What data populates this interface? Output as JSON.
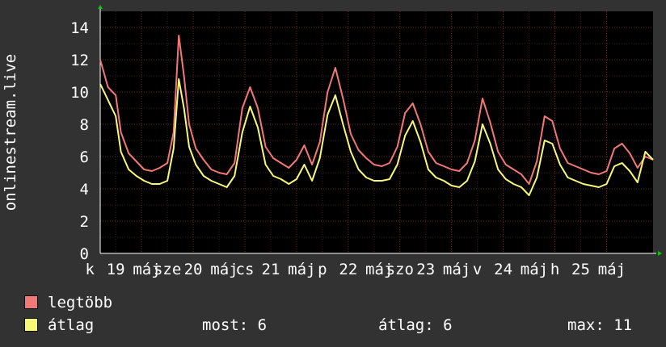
{
  "chart_data": {
    "type": "line",
    "ylabel": "onlinestream.live",
    "ylim": [
      0,
      15
    ],
    "yticks": [
      0,
      2,
      4,
      6,
      8,
      10,
      12,
      14
    ],
    "grid": true,
    "xtick_labels": [
      {
        "text": "k",
        "x": 0.0
      },
      {
        "text": "19",
        "x": 0.5
      },
      {
        "text": "máj",
        "x": 1.1
      },
      {
        "text": "sze",
        "x": 1.5
      },
      {
        "text": "20",
        "x": 2.0
      },
      {
        "text": "máj",
        "x": 2.6
      },
      {
        "text": "cs",
        "x": 3.0
      },
      {
        "text": "21",
        "x": 3.5
      },
      {
        "text": "máj",
        "x": 4.1
      },
      {
        "text": "p",
        "x": 4.5
      },
      {
        "text": "22",
        "x": 5.0
      },
      {
        "text": "máj",
        "x": 5.6
      },
      {
        "text": "szo",
        "x": 6.0
      },
      {
        "text": "23",
        "x": 6.5
      },
      {
        "text": "máj",
        "x": 7.1
      },
      {
        "text": "v",
        "x": 7.5
      },
      {
        "text": "24",
        "x": 8.0
      },
      {
        "text": "máj",
        "x": 8.6
      },
      {
        "text": "h",
        "x": 9.0
      },
      {
        "text": "25",
        "x": 9.5
      },
      {
        "text": "máj",
        "x": 10.1
      }
    ],
    "xlim": [
      0.2,
      10.9
    ],
    "series": [
      {
        "name": "legtöbb",
        "color": "#f07878",
        "x": [
          0.2,
          0.35,
          0.5,
          0.6,
          0.75,
          0.9,
          1.05,
          1.2,
          1.35,
          1.5,
          1.62,
          1.72,
          1.82,
          1.92,
          2.05,
          2.2,
          2.35,
          2.5,
          2.65,
          2.8,
          2.95,
          3.1,
          3.25,
          3.4,
          3.55,
          3.7,
          3.85,
          4.0,
          4.15,
          4.3,
          4.45,
          4.6,
          4.75,
          4.9,
          5.05,
          5.2,
          5.35,
          5.5,
          5.65,
          5.8,
          5.95,
          6.1,
          6.25,
          6.4,
          6.55,
          6.7,
          6.85,
          7.0,
          7.15,
          7.3,
          7.45,
          7.6,
          7.75,
          7.9,
          8.05,
          8.2,
          8.35,
          8.5,
          8.65,
          8.8,
          8.95,
          9.1,
          9.25,
          9.4,
          9.55,
          9.7,
          9.85,
          10.0,
          10.15,
          10.3,
          10.45,
          10.6,
          10.75,
          10.9
        ],
        "values": [
          12.0,
          10.3,
          9.8,
          7.5,
          6.2,
          5.7,
          5.2,
          5.1,
          5.3,
          5.6,
          7.5,
          13.5,
          11.0,
          8.0,
          6.5,
          5.8,
          5.2,
          5.0,
          4.9,
          5.6,
          9.0,
          10.3,
          9.0,
          6.6,
          5.9,
          5.6,
          5.3,
          5.8,
          6.7,
          5.5,
          6.9,
          10.0,
          11.5,
          9.6,
          7.4,
          6.4,
          5.9,
          5.5,
          5.4,
          5.6,
          6.6,
          8.7,
          9.3,
          8.0,
          6.3,
          5.6,
          5.4,
          5.2,
          5.1,
          5.6,
          7.0,
          9.6,
          8.1,
          6.3,
          5.5,
          5.2,
          4.9,
          4.3,
          5.7,
          8.5,
          8.2,
          6.5,
          5.6,
          5.4,
          5.2,
          5.0,
          4.9,
          5.1,
          6.5,
          6.8,
          6.2,
          5.3,
          6.0,
          5.8
        ]
      },
      {
        "name": "átlag",
        "color": "#f8f878",
        "x": [
          0.2,
          0.35,
          0.5,
          0.6,
          0.75,
          0.9,
          1.05,
          1.2,
          1.35,
          1.5,
          1.62,
          1.72,
          1.82,
          1.92,
          2.05,
          2.2,
          2.35,
          2.5,
          2.65,
          2.8,
          2.95,
          3.1,
          3.25,
          3.4,
          3.55,
          3.7,
          3.85,
          4.0,
          4.15,
          4.3,
          4.45,
          4.6,
          4.75,
          4.9,
          5.05,
          5.2,
          5.35,
          5.5,
          5.65,
          5.8,
          5.95,
          6.1,
          6.25,
          6.4,
          6.55,
          6.7,
          6.85,
          7.0,
          7.15,
          7.3,
          7.45,
          7.6,
          7.75,
          7.9,
          8.05,
          8.2,
          8.35,
          8.5,
          8.65,
          8.8,
          8.95,
          9.1,
          9.25,
          9.4,
          9.55,
          9.7,
          9.85,
          10.0,
          10.15,
          10.3,
          10.45,
          10.6,
          10.75,
          10.9
        ],
        "values": [
          10.5,
          9.5,
          8.5,
          6.3,
          5.2,
          4.8,
          4.5,
          4.3,
          4.3,
          4.5,
          6.5,
          10.8,
          9.0,
          6.6,
          5.5,
          4.8,
          4.5,
          4.3,
          4.1,
          4.8,
          7.5,
          9.1,
          7.8,
          5.5,
          4.8,
          4.6,
          4.3,
          4.6,
          5.5,
          4.5,
          5.9,
          8.6,
          9.8,
          8.0,
          6.3,
          5.2,
          4.7,
          4.5,
          4.5,
          4.6,
          5.5,
          7.3,
          8.2,
          6.9,
          5.2,
          4.7,
          4.5,
          4.2,
          4.1,
          4.5,
          5.7,
          8.0,
          6.8,
          5.2,
          4.6,
          4.3,
          4.1,
          3.6,
          4.7,
          7.0,
          6.8,
          5.5,
          4.7,
          4.5,
          4.3,
          4.2,
          4.1,
          4.3,
          5.4,
          5.6,
          5.1,
          4.4,
          6.3,
          5.8
        ]
      }
    ]
  },
  "legend": [
    {
      "label": "legtöbb",
      "color": "#f07878"
    },
    {
      "label": "átlag",
      "color": "#f8f878"
    }
  ],
  "stats": {
    "current": "most: 6",
    "average": "átlag: 6",
    "max": "max: 11"
  }
}
